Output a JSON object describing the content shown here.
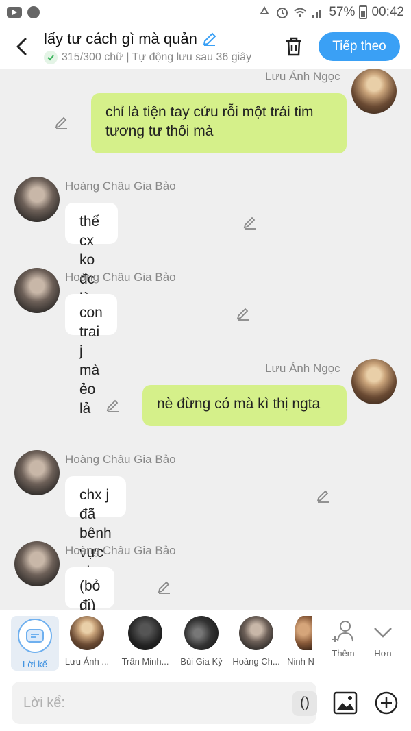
{
  "status_bar": {
    "battery": "57%",
    "time": "00:42"
  },
  "header": {
    "title": "lấy tư cách gì mà quản",
    "subtitle": "315/300 chữ | Tự động lưu sau 36 giây",
    "next_label": "Tiếp theo"
  },
  "messages": [
    {
      "sender": "Lưu Ánh Ngọc",
      "text": "chỉ là tiện tay cứu rỗi một trái tim tương tư thôi mà",
      "side": "right"
    },
    {
      "sender": "Hoàng Châu Gia Bảo",
      "text": "thế cx ko đc là hắn",
      "side": "left"
    },
    {
      "sender": "Hoàng Châu Gia Bảo",
      "text": "con trai j mà ẻo lả",
      "side": "left"
    },
    {
      "sender": "Lưu Ánh Ngọc",
      "text": "nè đừng có mà kì thị ngta",
      "side": "right"
    },
    {
      "sender": "Hoàng Châu Gia Bảo",
      "text": "chx j đã bênh vực cho hắn r à",
      "side": "left"
    },
    {
      "sender": "Hoàng Châu Gia Bảo",
      "text": "(bỏ đi)",
      "side": "left"
    }
  ],
  "characters": [
    {
      "label": "Lời kể"
    },
    {
      "label": "Lưu Ánh ..."
    },
    {
      "label": "Trần Minh..."
    },
    {
      "label": "Bùi Gia Kỳ"
    },
    {
      "label": "Hoàng Ch..."
    },
    {
      "label": "Ninh N"
    }
  ],
  "bar_actions": {
    "add_label": "Thêm",
    "more_label": "Hơn"
  },
  "input": {
    "placeholder": "Lời kể:",
    "paren": "()"
  },
  "colors": {
    "accent": "#3aa0f5",
    "my_bubble": "#d5f08a",
    "their_bubble": "#ffffff"
  }
}
